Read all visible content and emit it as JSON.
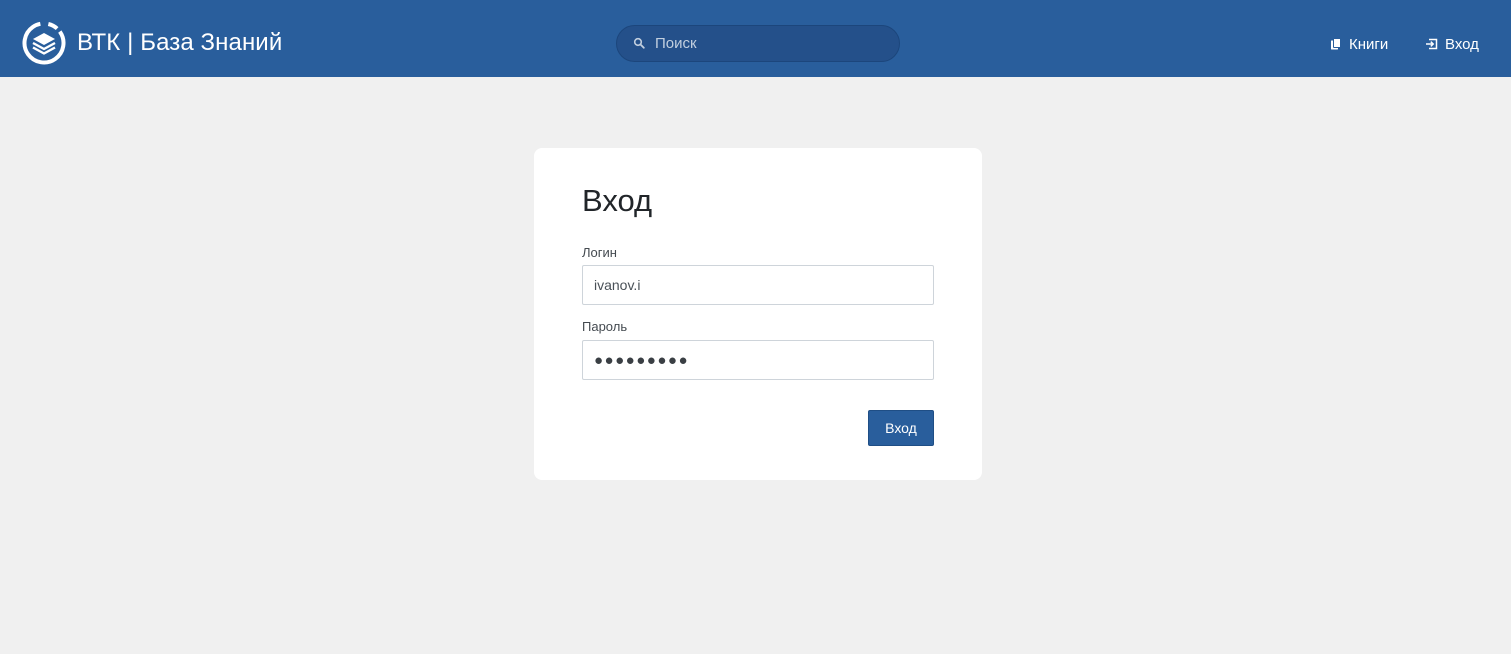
{
  "header": {
    "brand_title": "ВТК | База Знаний",
    "logo_icon": "stacked-books-logo-icon",
    "background_color": "#295e9c",
    "search": {
      "placeholder": "Поиск",
      "value": "",
      "icon": "search-icon"
    },
    "nav": {
      "books_label": "Книги",
      "books_icon": "books-icon",
      "login_label": "Вход",
      "login_icon": "login-icon"
    }
  },
  "login_form": {
    "title": "Вход",
    "login_label": "Логин",
    "login_value": "ivanov.i",
    "password_label": "Пароль",
    "password_display": "●●●●●●●●●",
    "submit_label": "Вход",
    "accent_color": "#295e9c"
  },
  "page": {
    "background_color": "#f0f0f0"
  }
}
